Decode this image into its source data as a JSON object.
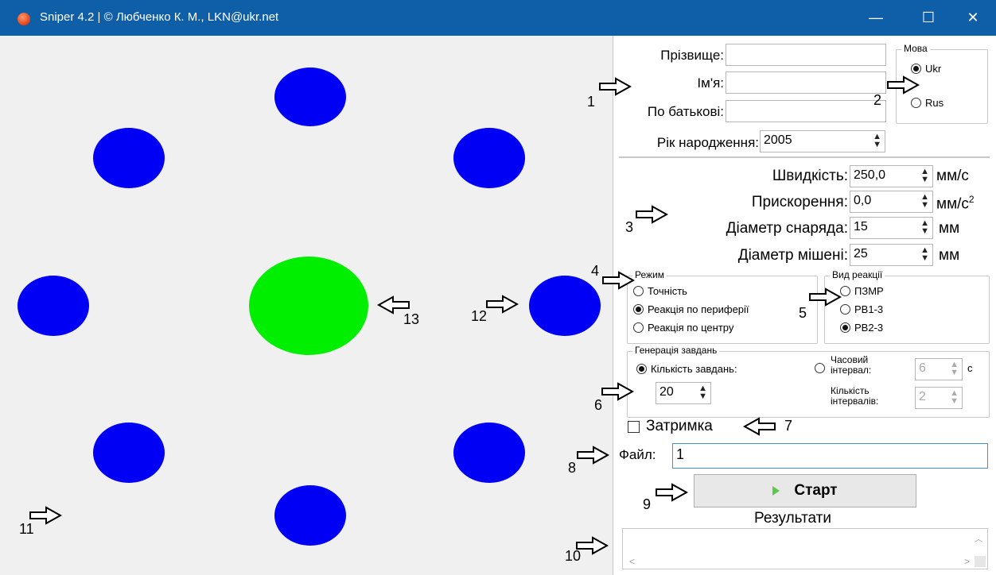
{
  "window": {
    "title": "Sniper 4.2 | © Любченко К. М., LKN@ukr.net",
    "minimize": "—",
    "maximize": "☐",
    "close": "✕"
  },
  "colors": {
    "target": "#0000f5",
    "center_target": "#00ef00"
  },
  "form": {
    "surname_label": "Прізвище:",
    "name_label": "Ім'я:",
    "patronymic_label": "По батькові:",
    "birth_year_label": "Рік народження:",
    "birth_year": "2005",
    "surname": "",
    "name": "",
    "patronymic": ""
  },
  "language": {
    "title": "Мова",
    "options": [
      "Ukr",
      "Rus"
    ],
    "selected": "Ukr"
  },
  "params": {
    "speed_label": "Швидкість:",
    "speed": "250,0",
    "speed_unit": "мм/с",
    "accel_label": "Прискорення:",
    "accel": "0,0",
    "accel_unit": "мм/с",
    "accel_unit_sup": "2",
    "shell_label": "Діаметр снаряда:",
    "shell": "15",
    "shell_unit": "мм",
    "target_label": "Діаметр мішені:",
    "target": "25",
    "target_unit": "мм"
  },
  "mode": {
    "title": "Режим",
    "options": [
      "Точність",
      "Реакція по периферії",
      "Реакція по центру"
    ],
    "selected": "Реакція по периферії"
  },
  "reaction": {
    "title": "Вид реакції",
    "options": [
      "ПЗМР",
      "РВ1-3",
      "РВ2-3"
    ],
    "selected": "РВ2-3"
  },
  "generation": {
    "title": "Генерація завдань",
    "count_label": "Кількість завдань:",
    "count": "20",
    "interval_label": "Часовий інтервал:",
    "interval": "6",
    "interval_unit": "с",
    "intervals_count_label": "Кількість інтервалів:",
    "intervals_count": "2"
  },
  "delay_label": "Затримка",
  "file_label": "Файл:",
  "file_value": "1",
  "start_label": "Старт",
  "results_label": "Результати",
  "markers": [
    "1",
    "2",
    "3",
    "4",
    "5",
    "6",
    "7",
    "8",
    "9",
    "10",
    "11",
    "12",
    "13"
  ]
}
